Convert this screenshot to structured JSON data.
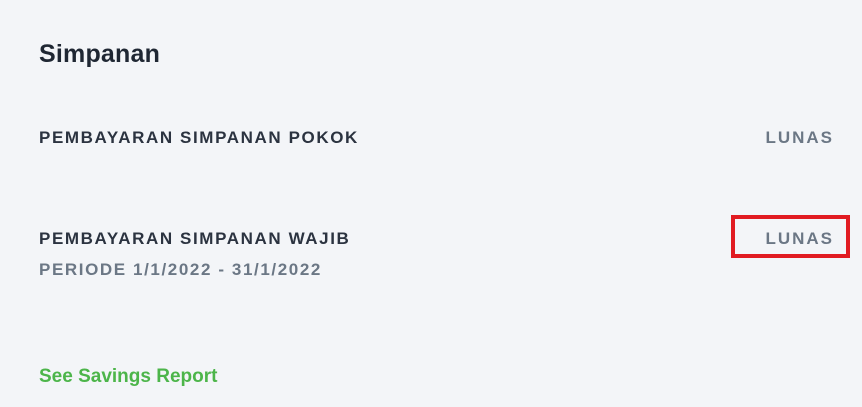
{
  "section": {
    "title": "Simpanan"
  },
  "items": [
    {
      "label": "PEMBAYARAN SIMPANAN POKOK",
      "status": "LUNAS"
    },
    {
      "label": "PEMBAYARAN SIMPANAN WAJIB",
      "period": "PERIODE 1/1/2022 - 31/1/2022",
      "status": "LUNAS"
    }
  ],
  "link": {
    "label": "See Savings Report"
  },
  "colors": {
    "background": "#f3f5f8",
    "heading": "#1f2733",
    "label": "#2b3340",
    "muted": "#6b7785",
    "link": "#4cb54a",
    "highlight": "#e11b22"
  }
}
